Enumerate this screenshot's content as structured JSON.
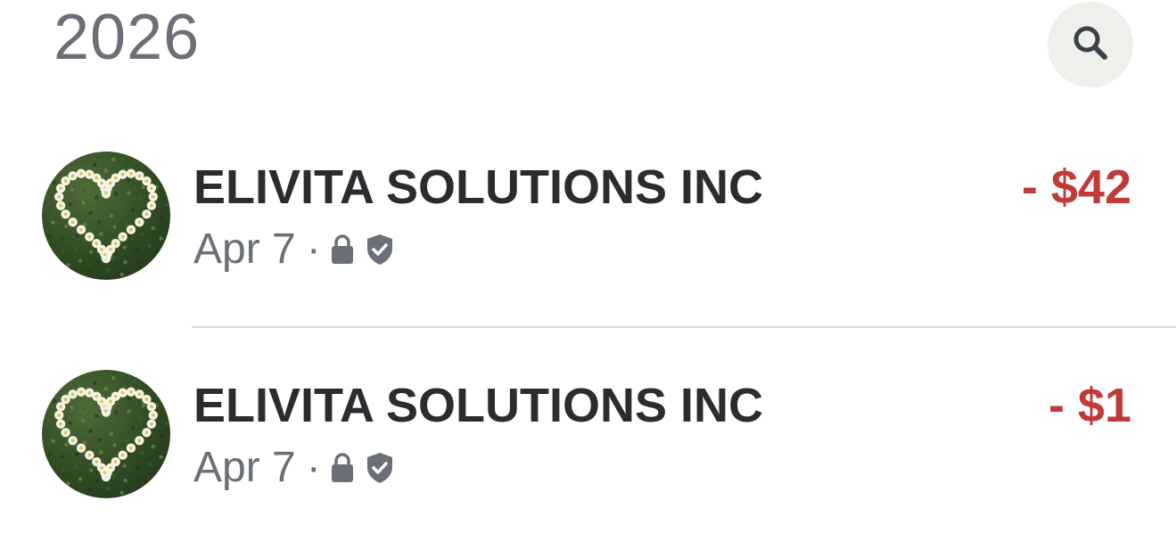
{
  "header": {
    "year": "2026"
  },
  "search": {
    "icon": "search-icon"
  },
  "transactions": [
    {
      "merchant": "ELIVITA SOLUTIONS INC",
      "date": "Apr 7",
      "separator": "·",
      "amount": "- $42",
      "avatar": "heart-of-daisies-on-grass",
      "status_icons": [
        "lock-icon",
        "shield-check-icon"
      ]
    },
    {
      "merchant": "ELIVITA SOLUTIONS INC",
      "date": "Apr 7",
      "separator": "·",
      "amount": "- $1",
      "avatar": "heart-of-daisies-on-grass",
      "status_icons": [
        "lock-icon",
        "shield-check-icon"
      ]
    }
  ],
  "colors": {
    "amount_negative": "#c03a37",
    "primary_text": "#2b2c30",
    "secondary_text": "#6b6f77",
    "search_button_bg": "#eef0ec",
    "divider": "#d4d6d9"
  }
}
